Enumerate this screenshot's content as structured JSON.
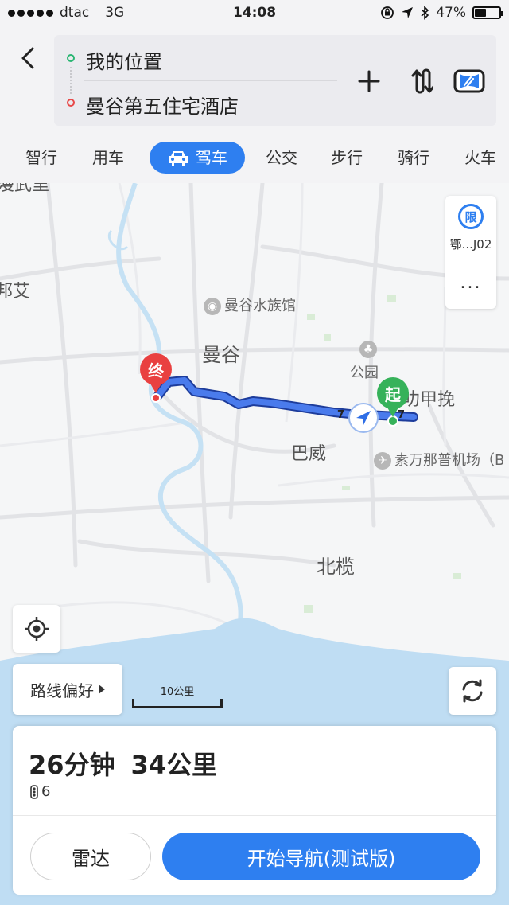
{
  "status_bar": {
    "carrier": "dtac",
    "network": "3G",
    "time": "14:08",
    "battery": "47%",
    "battery_level": 0.47
  },
  "route_input": {
    "start": "我的位置",
    "destination": "曼谷第五住宅酒店"
  },
  "transport_modes": [
    "智行",
    "用车",
    "驾车",
    "公交",
    "步行",
    "骑行",
    "火车"
  ],
  "active_mode": "驾车",
  "map": {
    "labels": {
      "edge_top": "漫武里",
      "edge_left": "邦艾",
      "aquarium": "曼谷水族馆",
      "bangkok": "曼谷",
      "park": "公园",
      "lat_krabang": "叻甲挽",
      "bang_wua": "巴威",
      "airport": "素万那普机场（B",
      "bang_bo": "北榄"
    },
    "markers": {
      "end": "终",
      "start": "起"
    },
    "route_badges": {
      "left": "7",
      "right": "7"
    },
    "side_panel": {
      "limit_badge": "限",
      "plate": "鄂...J02",
      "more": "..."
    },
    "route_preference": "路线偏好",
    "scale_label": "10公里"
  },
  "route_summary": {
    "duration": "26分钟",
    "distance": "34公里",
    "traffic_lights": "6"
  },
  "buttons": {
    "radar": "雷达",
    "start_navigation": "开始导航(测试版)"
  },
  "colors": {
    "accent": "#2E7FF0",
    "route": "#3E6FE6",
    "start_marker": "#36B25A",
    "end_marker": "#E94040",
    "water": "#BFDDF3"
  }
}
